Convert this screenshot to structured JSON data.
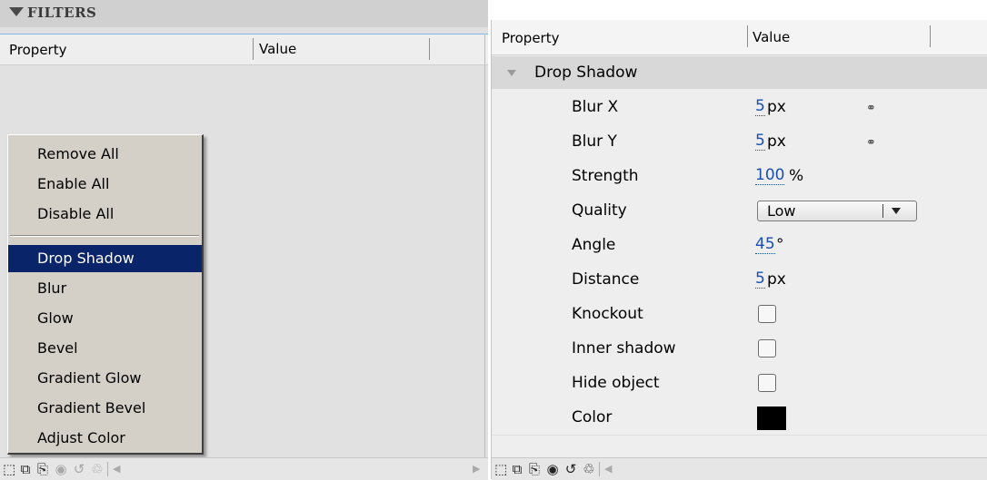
{
  "left_panel": {
    "section_title": "FILTERS",
    "columns": {
      "property": "Property",
      "value": "Value"
    },
    "context_menu": {
      "items": [
        {
          "label": "Remove All"
        },
        {
          "label": "Enable All"
        },
        {
          "label": "Disable All"
        },
        {
          "label": "Drop Shadow",
          "selected": true
        },
        {
          "label": "Blur"
        },
        {
          "label": "Glow"
        },
        {
          "label": "Bevel"
        },
        {
          "label": "Gradient Glow"
        },
        {
          "label": "Gradient Bevel"
        },
        {
          "label": "Adjust Color"
        }
      ]
    }
  },
  "right_panel": {
    "columns": {
      "property": "Property",
      "value": "Value"
    },
    "filter_group": {
      "label": "Drop Shadow",
      "expanded": true
    },
    "rows": {
      "blur_x": {
        "label": "Blur X",
        "value": "5",
        "unit": "px",
        "linked": true
      },
      "blur_y": {
        "label": "Blur Y",
        "value": "5",
        "unit": "px",
        "linked": true
      },
      "strength": {
        "label": "Strength",
        "value": "100",
        "unit": "%"
      },
      "quality": {
        "label": "Quality",
        "value": "Low"
      },
      "angle": {
        "label": "Angle",
        "value": "45",
        "unit": "°"
      },
      "distance": {
        "label": "Distance",
        "value": "5",
        "unit": "px"
      },
      "knockout": {
        "label": "Knockout",
        "checked": false
      },
      "inner_shadow": {
        "label": "Inner shadow",
        "checked": false
      },
      "hide_object": {
        "label": "Hide object",
        "checked": false
      },
      "color": {
        "label": "Color",
        "value": "#000000"
      }
    }
  },
  "colors": {
    "menu_selection": "#0a246a",
    "link_value": "#1a4fb0",
    "header_accent": "#7fb7e6"
  }
}
